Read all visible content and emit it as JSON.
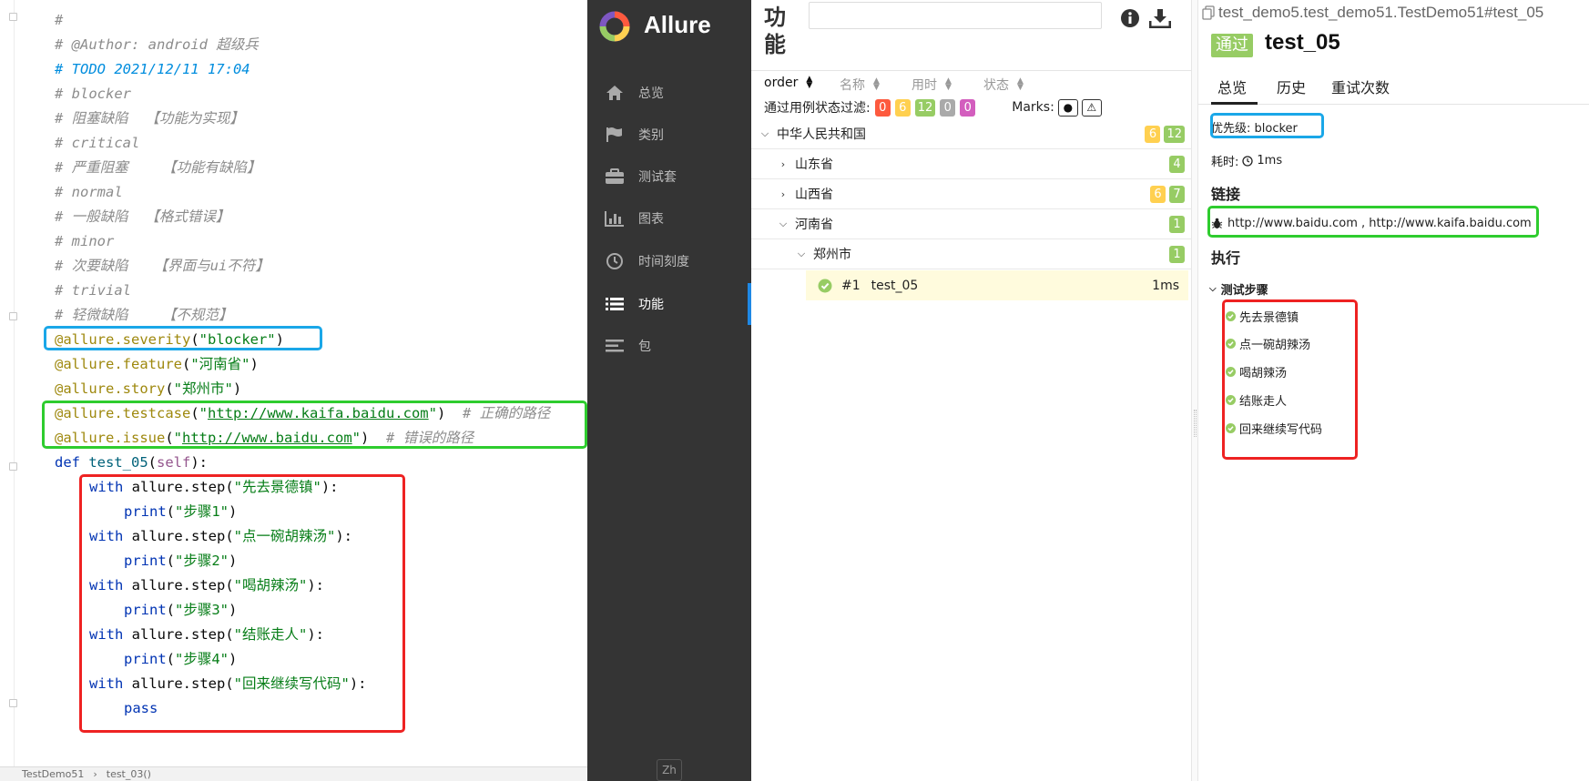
{
  "editor": {
    "comments": [
      "#",
      "# @Author: android 超级兵",
      "# TODO 2021/12/11 17:04",
      "# blocker",
      "# 阻塞缺陷  【功能为实现】",
      "# critical",
      "# 严重阻塞    【功能有缺陷】",
      "# normal",
      "# 一般缺陷  【格式错误】",
      "# minor",
      "# 次要缺陷   【界面与ui不符】",
      "# trivial",
      "# 轻微缺陷    【不规范】"
    ],
    "severity_deco": "@allure.severity",
    "severity_arg": "\"blocker\"",
    "feature_deco": "@allure.feature",
    "feature_arg": "\"河南省\"",
    "story_deco": "@allure.story",
    "story_arg": "\"郑州市\"",
    "testcase_deco": "@allure.testcase",
    "testcase_url": "http://www.kaifa.baidu.com",
    "testcase_comment": "# 正确的路径",
    "issue_deco": "@allure.issue",
    "issue_url": "http://www.baidu.com",
    "issue_comment": "# 错误的路径",
    "def_kw": "def",
    "func_name": "test_05",
    "self_kw": "self",
    "steps": [
      {
        "arg": "\"先去景德镇\"",
        "print_arg": "\"步骤1\""
      },
      {
        "arg": "\"点一碗胡辣汤\"",
        "print_arg": "\"步骤2\""
      },
      {
        "arg": "\"喝胡辣汤\"",
        "print_arg": "\"步骤3\""
      },
      {
        "arg": "\"结账走人\"",
        "print_arg": "\"步骤4\""
      },
      {
        "arg": "\"回来继续写代码\"",
        "pass_kw": "pass"
      }
    ],
    "with_kw": "with",
    "step_call": "allure.step",
    "print_kw": "print",
    "breadcrumb": [
      "TestDemo51",
      "test_03()"
    ]
  },
  "sidebar": {
    "brand": "Allure",
    "items": [
      {
        "label": "总览",
        "icon": "home-icon"
      },
      {
        "label": "类别",
        "icon": "flag-icon"
      },
      {
        "label": "测试套",
        "icon": "briefcase-icon"
      },
      {
        "label": "图表",
        "icon": "bar-chart-icon"
      },
      {
        "label": "时间刻度",
        "icon": "clock-icon"
      },
      {
        "label": "功能",
        "icon": "list-icon"
      },
      {
        "label": "包",
        "icon": "align-left-icon"
      }
    ],
    "active": "功能",
    "lang": "Zh"
  },
  "tree": {
    "title": "功能",
    "sort": [
      "order",
      "名称",
      "用时",
      "状态"
    ],
    "filter_label": "通过用例状态过滤:",
    "filter_counts": [
      "0",
      "6",
      "12",
      "0",
      "0"
    ],
    "marks_label": "Marks:",
    "rows": [
      {
        "label": "中华人民共和国",
        "yellow": "6",
        "green": "12"
      },
      {
        "label": "山东省",
        "green": "4"
      },
      {
        "label": "山西省",
        "yellow": "6",
        "green": "7"
      },
      {
        "label": "河南省",
        "green": "1"
      },
      {
        "label": "郑州市",
        "green": "1"
      }
    ],
    "leaf": {
      "num": "#1",
      "name": "test_05",
      "duration": "1ms"
    }
  },
  "detail": {
    "path": "test_demo5.test_demo51.TestDemo51#test_05",
    "status": "通过",
    "title": "test_05",
    "tabs": [
      "总览",
      "历史",
      "重试次数"
    ],
    "severity": "优先级: blocker",
    "duration_label": "耗时:",
    "duration": "1ms",
    "links_heading": "链接",
    "links": "http://www.baidu.com , http://www.kaifa.baidu.com",
    "exec_heading": "执行",
    "steps_heading": "测试步骤",
    "steps": [
      "先去景德镇",
      "点一碗胡辣汤",
      "喝胡辣汤",
      "结账走人",
      "回来继续写代码"
    ]
  },
  "colors": {
    "passed": "#97cc64",
    "broken": "#ffd050",
    "failed": "#fd5a3e",
    "skipped": "#aaaaaa",
    "unknown": "#d35ebe",
    "highlight_blue": "#1aa7e8",
    "highlight_green": "#2ecc2e",
    "highlight_red": "#ee2222"
  }
}
